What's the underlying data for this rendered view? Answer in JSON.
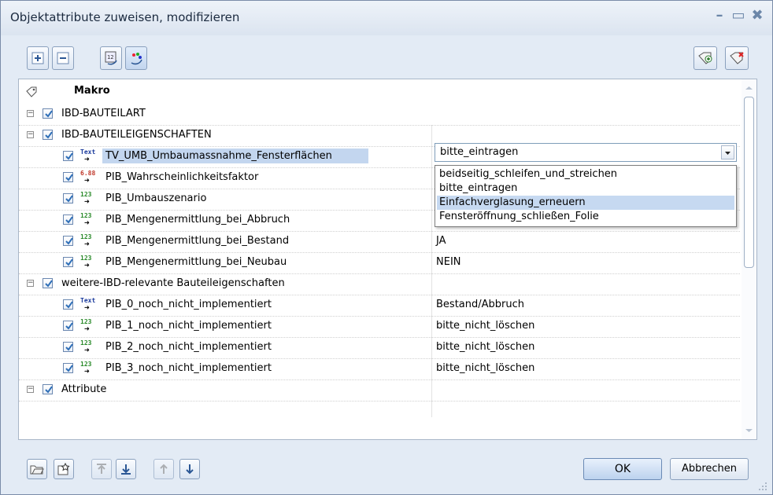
{
  "window": {
    "title": "Objektattribute zuweisen, modifizieren"
  },
  "header": {
    "label": "Makro"
  },
  "groups": [
    {
      "label": "IBD-BAUTEILART"
    },
    {
      "label": "IBD-BAUTEILEIGENSCHAFTEN",
      "items": [
        {
          "type_icon": "Text",
          "name": "TV_UMB_Umbaumassnahme_Fensterflächen",
          "value": "bitte_eintragen"
        },
        {
          "type_icon": "6.88",
          "name": "PIB_Wahrscheinlichkeitsfaktor",
          "value": ""
        },
        {
          "type_icon": "123",
          "name": "PIB_Umbauszenario",
          "value": ""
        },
        {
          "type_icon": "123",
          "name": "PIB_Mengenermittlung_bei_Abbruch",
          "value": ""
        },
        {
          "type_icon": "123",
          "name": "PIB_Mengenermittlung_bei_Bestand",
          "value": "JA"
        },
        {
          "type_icon": "123",
          "name": "PIB_Mengenermittlung_bei_Neubau",
          "value": "NEIN"
        }
      ]
    },
    {
      "label": "weitere-IBD-relevante Bauteileigenschaften",
      "items": [
        {
          "type_icon": "Text",
          "name": "PIB_0_noch_nicht_implementiert",
          "value": "Bestand/Abbruch"
        },
        {
          "type_icon": "123",
          "name": "PIB_1_noch_nicht_implementiert",
          "value": "bitte_nicht_löschen"
        },
        {
          "type_icon": "123",
          "name": "PIB_2_noch_nicht_implementiert",
          "value": "bitte_nicht_löschen"
        },
        {
          "type_icon": "123",
          "name": "PIB_3_noch_nicht_implementiert",
          "value": "bitte_nicht_löschen"
        }
      ]
    },
    {
      "label": "Attribute"
    }
  ],
  "dropdown": {
    "selected": "bitte_eintragen",
    "options": [
      "beidseitig_schleifen_und_streichen",
      "bitte_eintragen",
      "Einfachverglasung_erneuern",
      "Fensteröffnung_schließen_Folie"
    ],
    "highlighted_index": 2
  },
  "buttons": {
    "ok": "OK",
    "cancel": "Abbrechen"
  },
  "colors": {
    "selection": "#c3d6ef",
    "check": "#2f6fb8",
    "type_text_icon": "#1a3a9c",
    "type_number_icon": "#2a8a2a",
    "type_decimal_icon": "#c0392b"
  }
}
